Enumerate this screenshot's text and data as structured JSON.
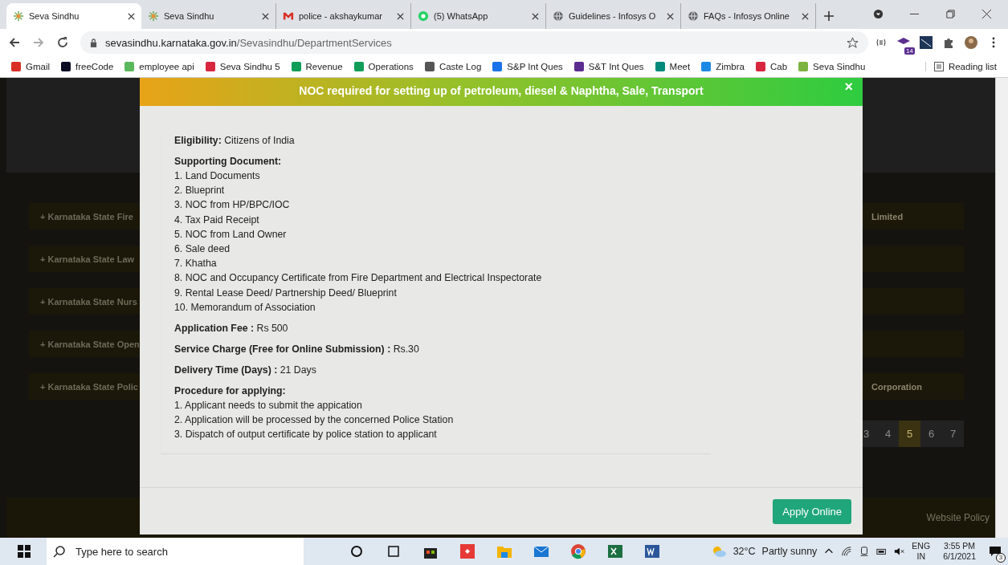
{
  "tabs": [
    {
      "title": "Seva Sindhu",
      "selected": true
    },
    {
      "title": "Seva Sindhu",
      "selected": false
    },
    {
      "title": "police - akshaykumar",
      "selected": false
    },
    {
      "title": "(5) WhatsApp",
      "selected": false
    },
    {
      "title": "Guidelines - Infosys O",
      "selected": false
    },
    {
      "title": "FAQs - Infosys Online",
      "selected": false
    }
  ],
  "address": {
    "host": "sevasindhu.karnataka.gov.in",
    "path": "/Sevasindhu/DepartmentServices"
  },
  "extension_badge": "14",
  "bookmarks": [
    {
      "label": "Gmail",
      "color": "#d93025"
    },
    {
      "label": "freeCode",
      "color": "#0a0a23"
    },
    {
      "label": "employee api",
      "color": "#5cb85c"
    },
    {
      "label": "Seva Sindhu 5",
      "color": "#d7263d"
    },
    {
      "label": "Revenue",
      "color": "#0f9d58"
    },
    {
      "label": "Operations",
      "color": "#0f9d58"
    },
    {
      "label": "Caste Log",
      "color": "#555555"
    },
    {
      "label": "S&P Int Ques",
      "color": "#1a73e8"
    },
    {
      "label": "S&T Int Ques",
      "color": "#5b2d90"
    },
    {
      "label": "Meet",
      "color": "#00897b"
    },
    {
      "label": "Zimbra",
      "color": "#1e88e5"
    },
    {
      "label": "Cab",
      "color": "#d7263d"
    },
    {
      "label": "Seva Sindhu",
      "color": "#7cb342"
    }
  ],
  "reading_list": "Reading list",
  "background": {
    "left_rows": [
      "+ Karnataka State Fire",
      "+ Karnataka State Law",
      "+ Karnataka State Nurs",
      "+ Karnataka State Open",
      "+ Karnataka State Polic"
    ],
    "right_rows": [
      "Limited",
      "",
      "",
      "",
      "Corporation"
    ],
    "pages": [
      {
        "label": "3",
        "selected": false
      },
      {
        "label": "4",
        "selected": false
      },
      {
        "label": "5",
        "selected": true
      },
      {
        "label": "6",
        "selected": false
      },
      {
        "label": "7",
        "selected": false
      }
    ],
    "footer_link": "Website Policy"
  },
  "modal": {
    "title": "NOC required for setting up of petroleum, diesel & Naphtha, Sale, Transport",
    "close": "×",
    "eligibility": "**Eligibility:** Citizens of India",
    "documents_heading": "Supporting Document:",
    "documents": [
      "1. Land Documents",
      "2. Blueprint",
      "3. NOC from HP/BPC/IOC",
      "4. Tax Paid Receipt",
      "5. NOC from Land Owner",
      "6. Sale deed",
      "7. Khatha",
      "8. NOC and Occupancy Certificate from Fire Department and Electrical Inspectorate",
      "9. Rental Lease Deed/ Partnership Deed/ Blueprint",
      "10. Memorandum of Association"
    ],
    "facts": [
      "**Application Fee :** Rs 500",
      "**Service Charge (Free for Online Submission) :** Rs.30",
      "**Delivery Time (Days) :** 21 Days"
    ],
    "procedure_heading": "Procedure for applying:",
    "procedure": [
      "1. Applicant needs to submit the appication",
      "2. Application will be processed by the concerned Police Station",
      "3. Dispatch of output certificate by police station to applicant"
    ],
    "button": "Apply Online"
  },
  "taskbar": {
    "search_placeholder": "Type here to search",
    "weather": "32°C",
    "weather_text": "Partly sunny",
    "language": "ENG",
    "region": "IN",
    "time": "3:55 PM",
    "date": "6/1/2021",
    "notifications": "3"
  }
}
